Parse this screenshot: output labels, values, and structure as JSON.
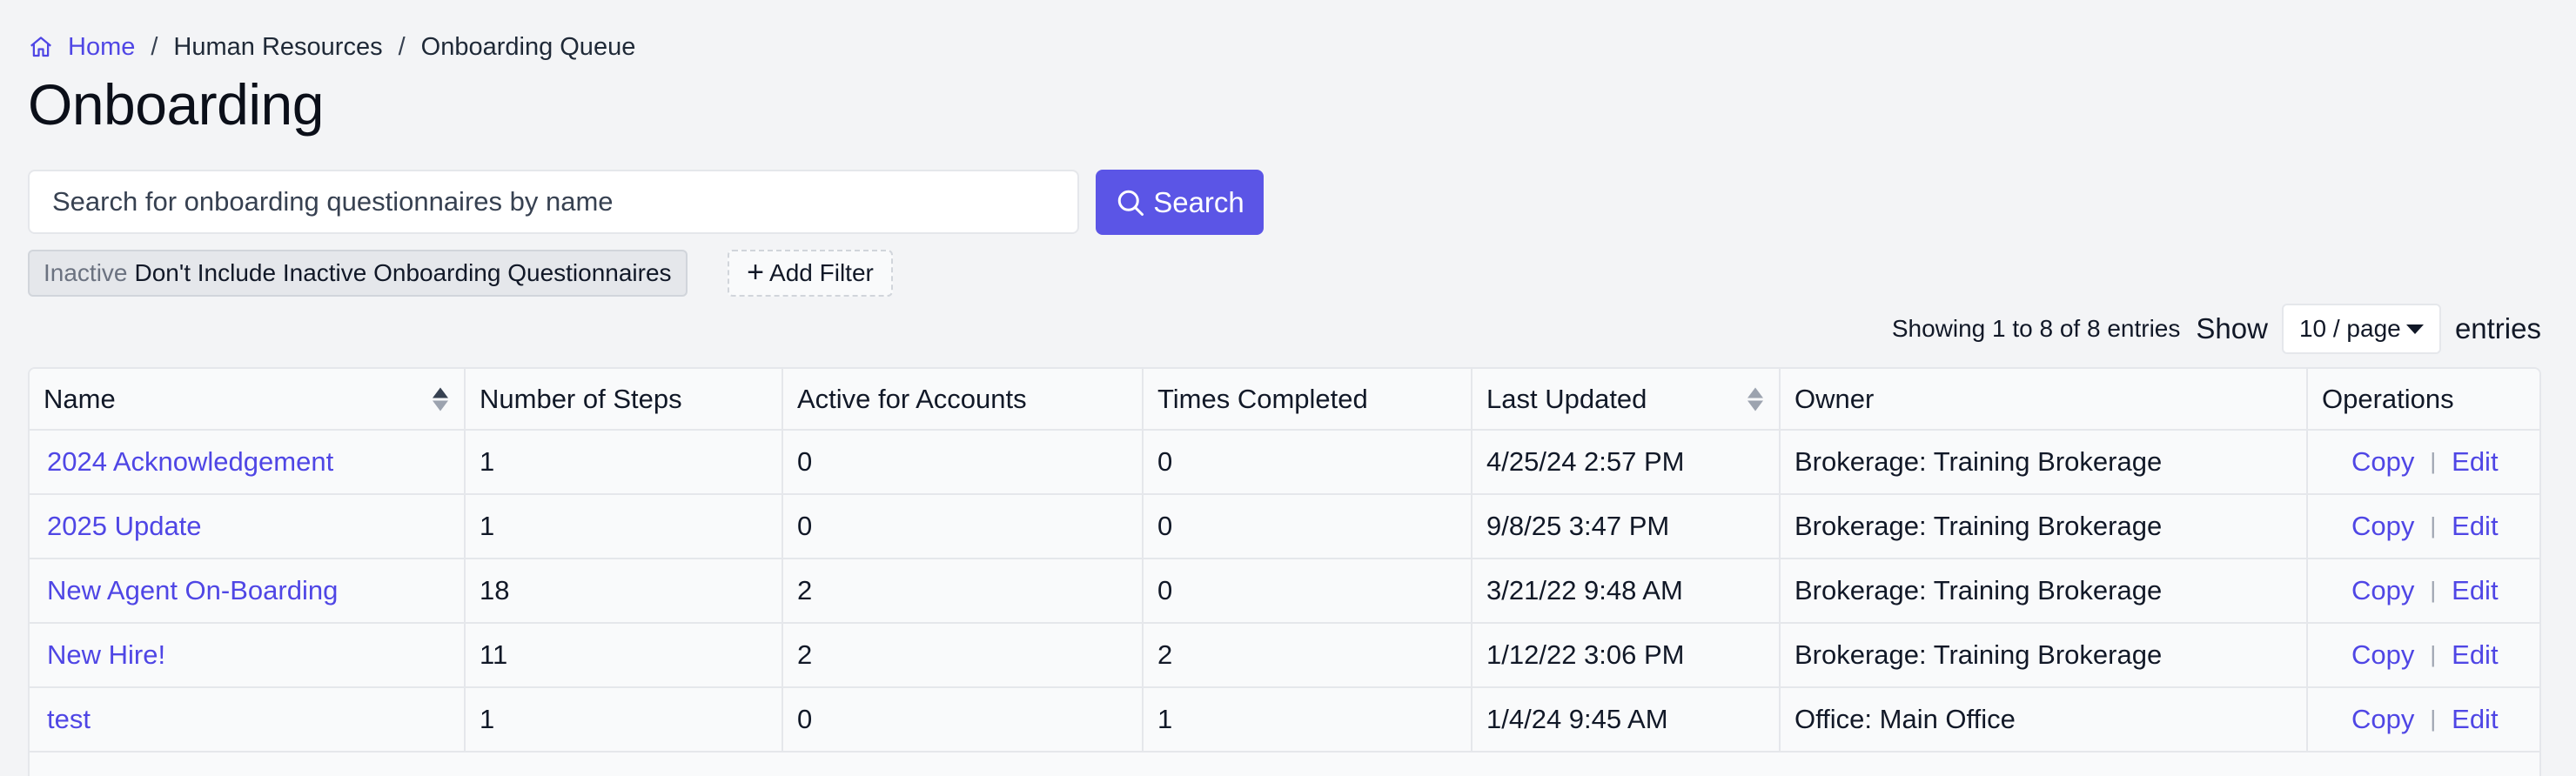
{
  "breadcrumb": {
    "home": "Home",
    "section": "Human Resources",
    "current": "Onboarding Queue",
    "separator": "/"
  },
  "page": {
    "title": "Onboarding"
  },
  "search": {
    "placeholder": "Search for onboarding questionnaires by name",
    "value": "",
    "button_label": "Search"
  },
  "filters": {
    "active": [
      {
        "key": "Inactive",
        "value": "Don't Include Inactive Onboarding Questionnaires"
      }
    ],
    "add_label": "Add Filter"
  },
  "pagination": {
    "showing": "Showing 1 to 8 of 8 entries",
    "show_label": "Show",
    "page_size": "10 / page",
    "entries_label": "entries"
  },
  "table": {
    "headers": [
      "Name",
      "Number of Steps",
      "Active for Accounts",
      "Times Completed",
      "Last Updated",
      "Owner",
      "Operations"
    ],
    "rows": [
      {
        "name": "2024 Acknowledgement",
        "steps": "1",
        "active": "0",
        "completed": "0",
        "updated": "4/25/24 2:57 PM",
        "owner": "Brokerage: Training Brokerage"
      },
      {
        "name": "2025 Update",
        "steps": "1",
        "active": "0",
        "completed": "0",
        "updated": "9/8/25 3:47 PM",
        "owner": "Brokerage: Training Brokerage"
      },
      {
        "name": "New Agent On-Boarding",
        "steps": "18",
        "active": "2",
        "completed": "0",
        "updated": "3/21/22 9:48 AM",
        "owner": "Brokerage: Training Brokerage"
      },
      {
        "name": "New Hire!",
        "steps": "11",
        "active": "2",
        "completed": "2",
        "updated": "1/12/22 3:06 PM",
        "owner": "Brokerage: Training Brokerage"
      },
      {
        "name": "test",
        "steps": "1",
        "active": "0",
        "completed": "1",
        "updated": "1/4/24 9:45 AM",
        "owner": "Office: Main Office"
      }
    ],
    "operations": {
      "copy": "Copy",
      "edit": "Edit",
      "separator": "|"
    }
  },
  "colors": {
    "accent": "#4f46e5",
    "button": "#5b55e6",
    "background": "#f3f4f6"
  }
}
